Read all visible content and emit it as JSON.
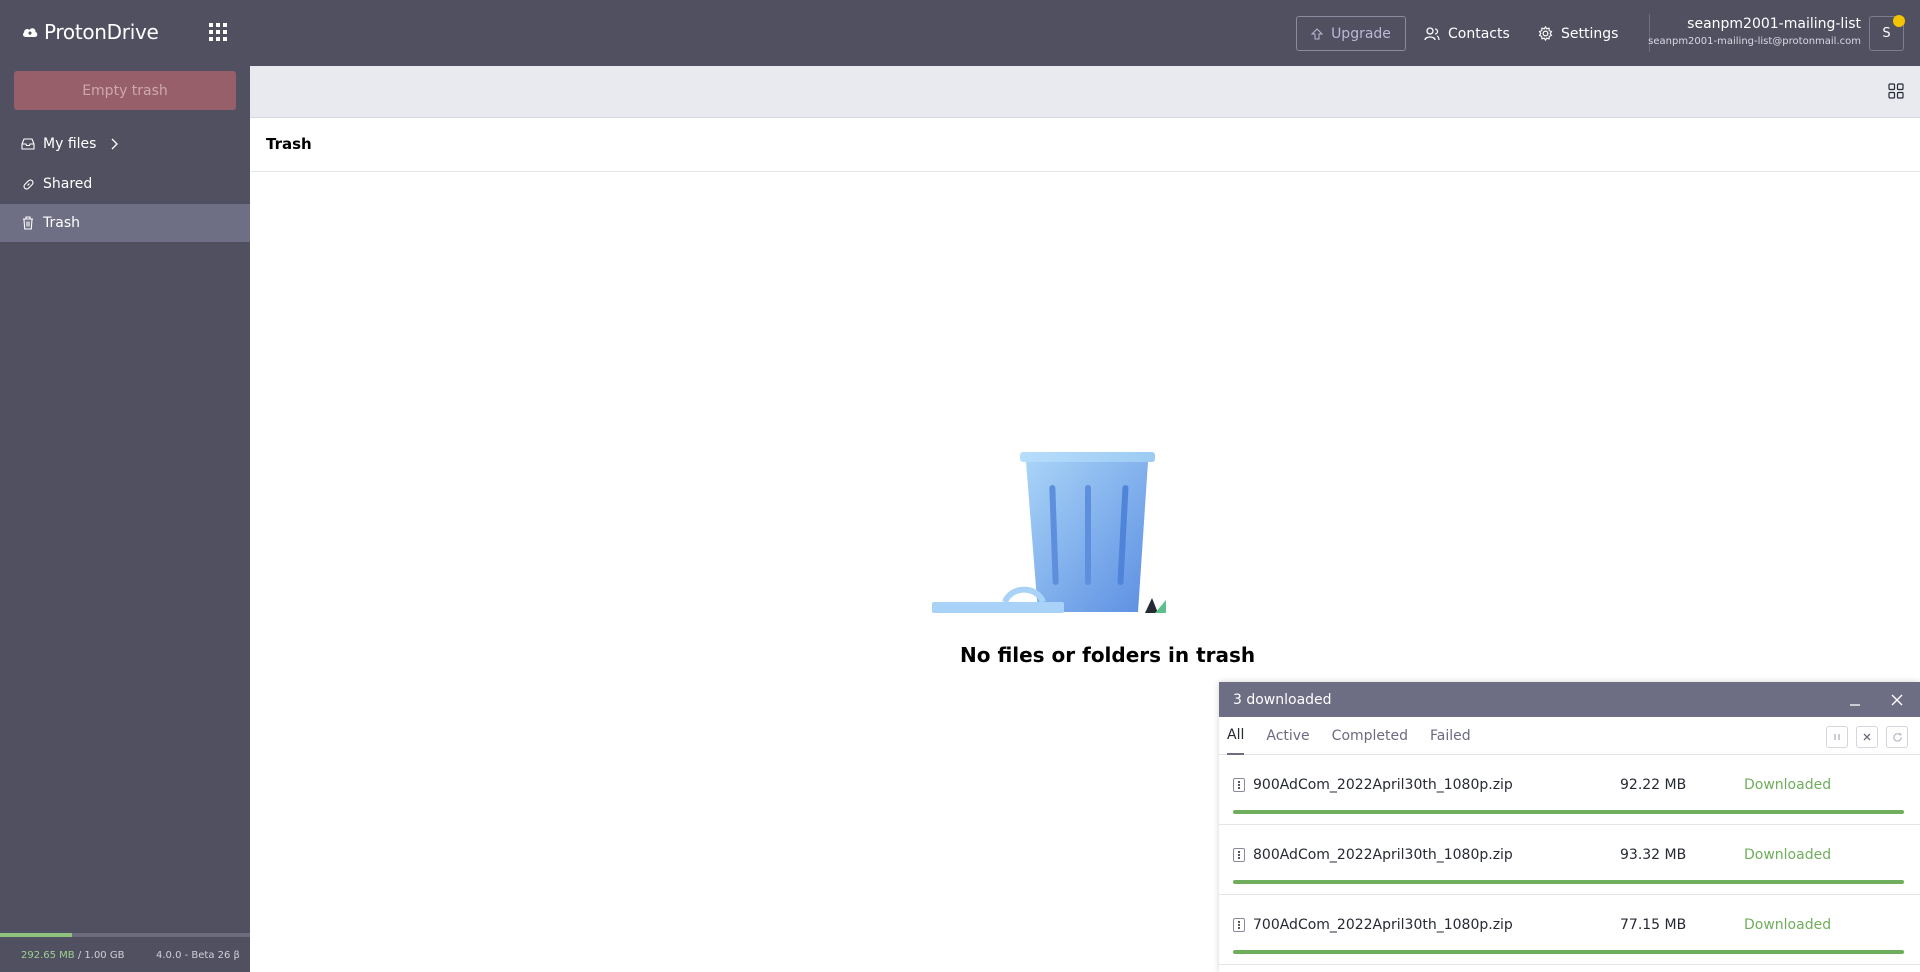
{
  "header": {
    "brand": "ProtonDrive",
    "upgrade_label": "Upgrade",
    "contacts_label": "Contacts",
    "settings_label": "Settings",
    "user_name": "seanpm2001-mailing-list",
    "user_email": "seanpm2001-mailing-list@protonmail.com",
    "avatar_initial": "S"
  },
  "sidebar": {
    "empty_trash_label": "Empty trash",
    "items": [
      {
        "label": "My files",
        "icon": "inbox-icon"
      },
      {
        "label": "Shared",
        "icon": "link-icon"
      },
      {
        "label": "Trash",
        "icon": "trash-icon",
        "active": true
      }
    ],
    "storage_used": "292.65 MB",
    "storage_sep": " / ",
    "storage_total": "1.00 GB",
    "storage_fraction": 0.286,
    "version": "4.0.0 - Beta 26 β"
  },
  "main": {
    "title": "Trash",
    "empty_message": "No files or folders in trash"
  },
  "transfers": {
    "title": "3 downloaded",
    "tabs": [
      "All",
      "Active",
      "Completed",
      "Failed"
    ],
    "active_tab": "All",
    "rows": [
      {
        "name": "900AdCom_2022April30th_1080p.zip",
        "size": "92.22 MB",
        "status": "Downloaded",
        "progress": 1.0
      },
      {
        "name": "800AdCom_2022April30th_1080p.zip",
        "size": "93.32 MB",
        "status": "Downloaded",
        "progress": 1.0
      },
      {
        "name": "700AdCom_2022April30th_1080p.zip",
        "size": "77.15 MB",
        "status": "Downloaded",
        "progress": 1.0
      }
    ]
  },
  "colors": {
    "header_bg": "#505061",
    "sidebar_active": "#6e6e84",
    "success": "#6fae5c",
    "danger_button": "#965f6a"
  }
}
